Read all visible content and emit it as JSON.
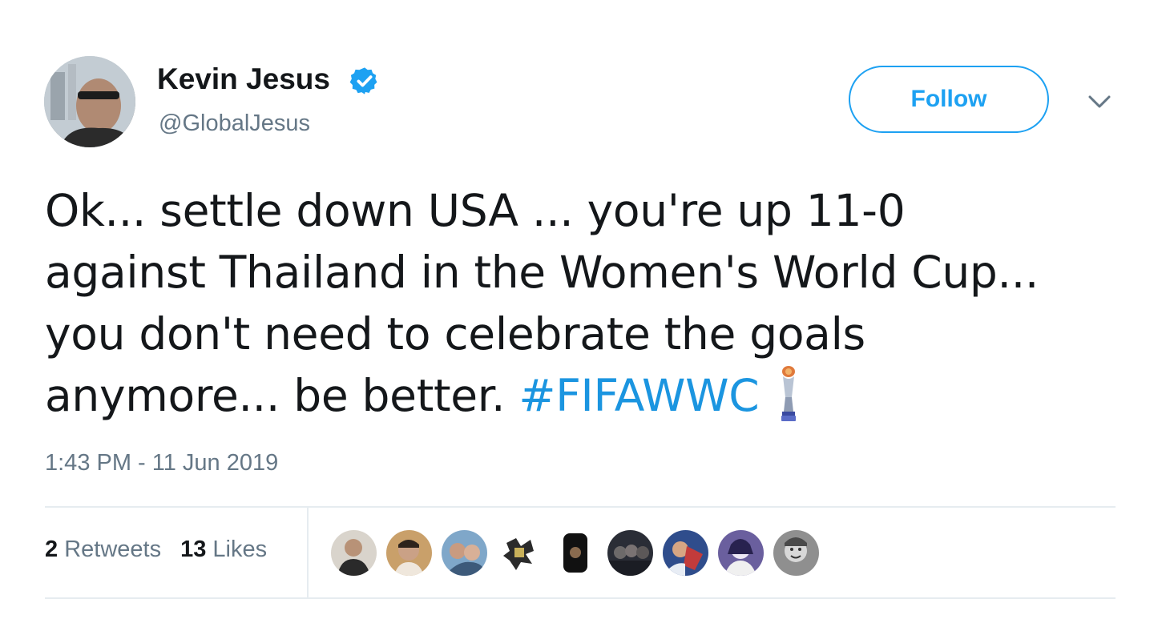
{
  "user": {
    "display_name": "Kevin Jesus",
    "handle": "@GlobalJesus",
    "verified": true,
    "avatar_icon": "user-avatar"
  },
  "follow_button": {
    "label": "Follow"
  },
  "menu_icon": "chevron-down-icon",
  "tweet": {
    "lines": [
      "Ok... settle down USA ... you're up 11-0",
      "against Thailand in the Women's World Cup...",
      "you don't need to celebrate the goals",
      "anymore... be better. "
    ],
    "hashtag": "#FIFAWWC",
    "emoji_icon": "world-cup-trophy-icon",
    "timestamp": "1:43 PM - 11 Jun 2019"
  },
  "stats": {
    "retweets_count": "2",
    "retweets_label": "Retweets",
    "likes_count": "13",
    "likes_label": "Likes"
  },
  "likers": [
    {
      "icon": "liker-avatar-1"
    },
    {
      "icon": "liker-avatar-2"
    },
    {
      "icon": "liker-avatar-3"
    },
    {
      "icon": "liker-avatar-4"
    },
    {
      "icon": "liker-avatar-5"
    },
    {
      "icon": "liker-avatar-6"
    },
    {
      "icon": "liker-avatar-7"
    },
    {
      "icon": "liker-avatar-8"
    },
    {
      "icon": "liker-avatar-9"
    }
  ],
  "colors": {
    "accent": "#1da1f2",
    "hashtag": "#1b95e0",
    "text_primary": "#14171a",
    "text_secondary": "#657786",
    "divider": "#e6ecf0"
  }
}
